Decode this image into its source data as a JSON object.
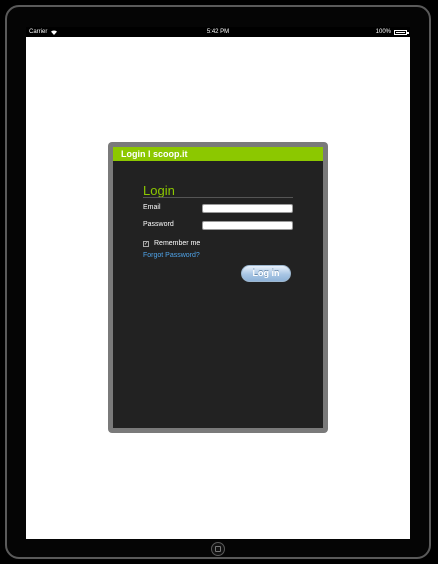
{
  "status_bar": {
    "carrier": "Carrier",
    "time": "5:42 PM",
    "battery": "100%",
    "battery_level": 1.0,
    "icons": [
      "wifi-icon",
      "battery-icon"
    ]
  },
  "dialog": {
    "header_title": "Login I scoop.it",
    "title": "Login",
    "email_label": "Email",
    "email_value": "",
    "password_label": "Password",
    "password_value": "",
    "remember_label": "Remember me",
    "remember_checked": true,
    "forgot_link": "Forgot Password?",
    "login_button": "Log in"
  },
  "colors": {
    "accent": "#8cc800",
    "dialog_background": "#222222",
    "link": "#4fa3e8"
  }
}
